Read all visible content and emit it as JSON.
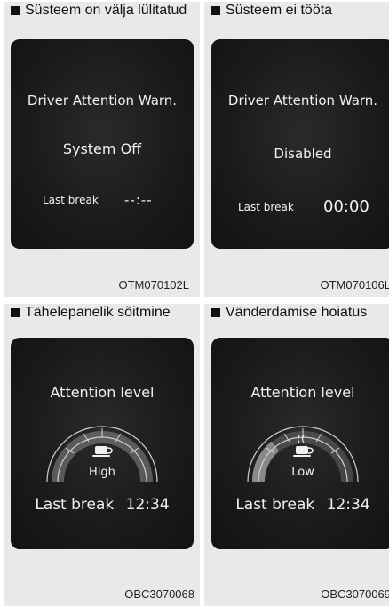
{
  "panels": [
    {
      "caption": "Süsteem on välja lülitatud",
      "title": "Driver Attention Warn.",
      "status": "System Off",
      "break_label": "Last break",
      "break_value": "--:--",
      "code": "OTM070102L"
    },
    {
      "caption": "Süsteem ei tööta",
      "title": "Driver Attention Warn.",
      "status": "Disabled",
      "break_label": "Last break",
      "break_value": "00:00",
      "code": "OTM070106L"
    },
    {
      "caption": "Tähelepanelik sõitmine",
      "title": "Attention level",
      "gauge": {
        "level_label": "High",
        "level_fraction": 0.75,
        "icon": "coffee-cup-icon"
      },
      "break_label": "Last break",
      "break_value": "12:34",
      "code": "OBC3070068"
    },
    {
      "caption": "Vänderdamise hoiatus",
      "title": "Attention level",
      "gauge": {
        "level_label": "Low",
        "level_fraction": 0.25,
        "icon": "hot-coffee-icon"
      },
      "break_label": "Last break",
      "break_value": "12:34",
      "code": "OBC3070069"
    }
  ]
}
